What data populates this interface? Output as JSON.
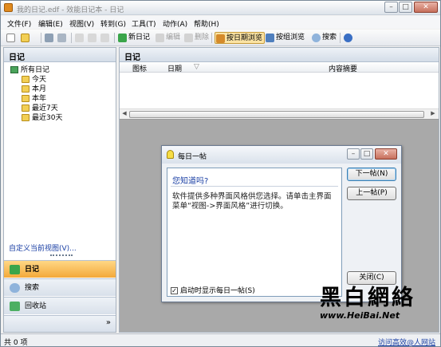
{
  "window": {
    "title": "我的日记.edf - 效能日记本 - 日记"
  },
  "menu": [
    "文件(F)",
    "编辑(E)",
    "视图(V)",
    "转到(G)",
    "工具(T)",
    "动作(A)",
    "帮助(H)"
  ],
  "toolbar": {
    "new_diary": "新日记",
    "edit": "编辑",
    "delete": "删除",
    "by_date": "按日期浏览",
    "by_group": "按组浏览",
    "search": "搜索"
  },
  "left_pane": {
    "header": "日记",
    "tree": {
      "root": "所有日记",
      "children": [
        "今天",
        "本月",
        "本年",
        "最近7天",
        "最近30天"
      ]
    },
    "customize_link": "自定义当前视图(V)...",
    "nav": {
      "diary": "日记",
      "search": "搜索",
      "recycle": "回收站"
    }
  },
  "right_pane": {
    "header": "日记",
    "columns": [
      "图标",
      "日期",
      "内容摘要"
    ]
  },
  "dialog": {
    "title": "每日一帖",
    "question": "您知道吗?",
    "tip": "软件提供多种界面风格供您选择。请单击主界面菜单“视图->界面风格”进行切换。",
    "checkbox_label": "启动时显示每日一帖(S)",
    "checkbox_checked": true,
    "next_button": "下一帖(N)",
    "prev_button": "上一帖(P)",
    "close_button": "关闭(C)"
  },
  "status": {
    "left": "共 0 项",
    "right": "访问高效@人网站"
  },
  "watermark": {
    "cn": "黑白網絡",
    "en": "www.HeiBai.Net"
  },
  "colors": {
    "accent": "#f3a93a",
    "link": "#1a3fa4",
    "workspace": "#a9a9a9"
  }
}
